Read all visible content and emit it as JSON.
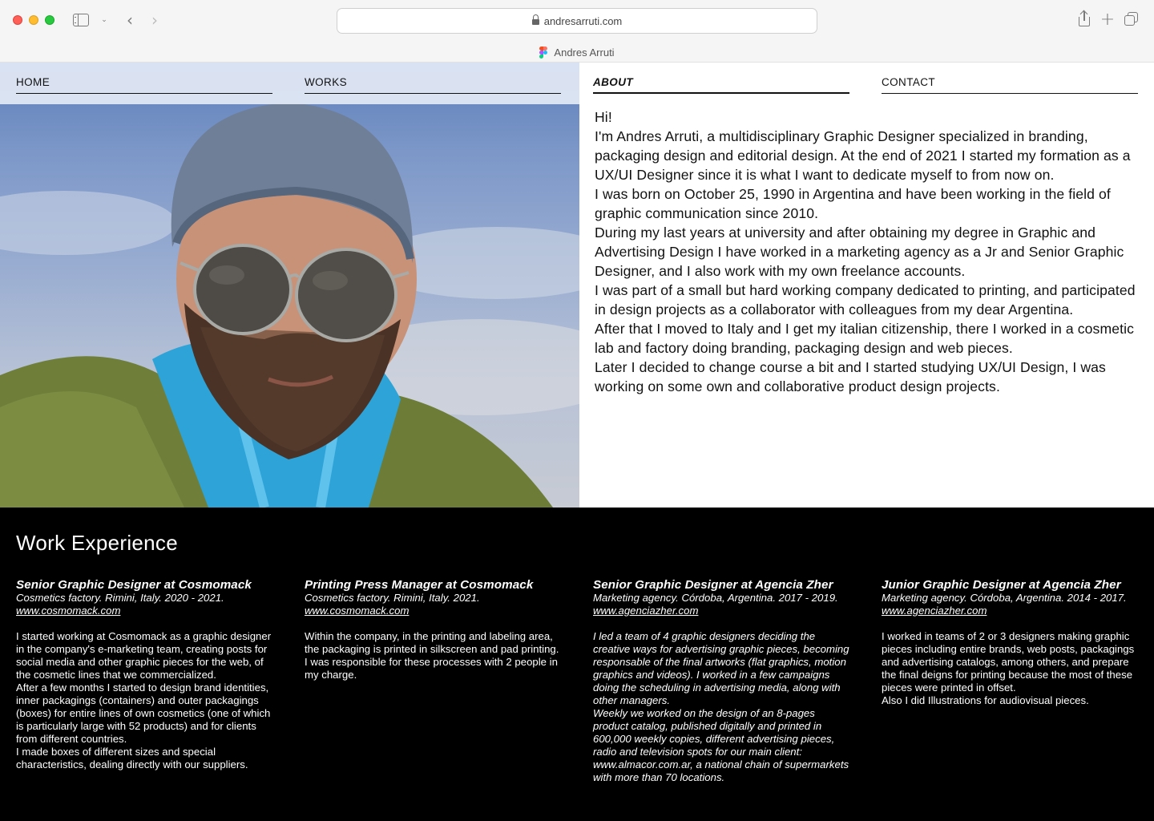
{
  "browser": {
    "url": "andresarruti.com",
    "tab_title": "Andres Arruti"
  },
  "nav": {
    "items": [
      "HOME",
      "WORKS",
      "ABOUT",
      "CONTACT"
    ],
    "active": "ABOUT"
  },
  "about": {
    "paragraphs": [
      "Hi!",
      "I'm Andres Arruti, a multidisciplinary Graphic Designer specialized in branding, packaging design and editorial design. At the end of 2021 I started my formation as a UX/UI Designer since it is what I want to dedicate myself to from now on.",
      "I was born on October 25, 1990 in Argentina and have been working in the field of graphic communication since 2010.",
      "During my last years at university and after obtaining my degree in Graphic and Advertising Design I have worked in a marketing agency as a Jr and Senior Graphic Designer, and I also work with my own freelance accounts.",
      "I was part of a small but hard working company dedicated to printing, and participated in design projects as a collaborator with colleagues from my dear Argentina.",
      "After that I moved to Italy and I get my italian citizenship, there I worked in a cosmetic lab and factory doing branding, packaging design and web pieces.",
      "Later I decided to change course a bit and I started studying UX/UI Design, I was working on some own and collaborative product design projects."
    ]
  },
  "work_experience": {
    "title": "Work Experience",
    "jobs": [
      {
        "title": "Senior Graphic Designer at Cosmomack",
        "meta": "Cosmetics factory. Rimini, Italy.  2020 - 2021.",
        "link": "www.cosmomack.com",
        "description": "I started working at Cosmomack as a graphic designer in the company's e-marketing team, creating posts for social media and other graphic pieces for the web, of the cosmetic lines that we commercialized.\nAfter a few months I started to design brand identities, inner packagings (containers) and outer packagings (boxes) for entire lines of own cosmetics (one of which is particularly large with 52 products) and for clients from different countries.\nI made boxes of different sizes and special characteristics, dealing directly with our suppliers.",
        "italic_description": false
      },
      {
        "title": "Printing Press Manager at Cosmomack",
        "meta": "Cosmetics factory. Rimini, Italy. 2021.",
        "link": "www.cosmomack.com",
        "description": "Within the company, in the printing and labeling area, the packaging is printed in silkscreen and pad printing. I was responsible for these processes with 2 people in my charge.",
        "italic_description": false
      },
      {
        "title": "Senior Graphic Designer at Agencia Zher",
        "meta": "Marketing agency. Córdoba, Argentina. 2017 - 2019.",
        "link": "www.agenciazher.com",
        "description": "I led a team of 4 graphic designers deciding the creative ways for advertising graphic pieces, becoming responsable of the final artworks (flat graphics, motion graphics and videos). I worked in a few campaigns doing the scheduling in advertising media, along with other managers.\nWeekly we worked on the design of an 8-pages product catalog, published digitally and printed in 600,000 weekly copies, different advertising pieces, radio and television spots for our main client: www.almacor.com.ar, a national chain of supermarkets with more than 70 locations.",
        "italic_description": true
      },
      {
        "title": "Junior Graphic Designer at Agencia Zher",
        "meta": "Marketing agency. Córdoba, Argentina. 2014 - 2017.",
        "link": "www.agenciazher.com",
        "description": "I worked in teams of 2 or 3 designers making graphic pieces including entire brands, web posts, packagings and advertising catalogs, among others, and prepare the final deigns for printing because the most of these pieces were printed in offset.\nAlso I did Illustrations for audiovisual pieces.",
        "italic_description": false
      }
    ]
  },
  "colors": {
    "nav_overlay": "#e4eaf6",
    "work_bg": "#000000",
    "text": "#111111"
  }
}
